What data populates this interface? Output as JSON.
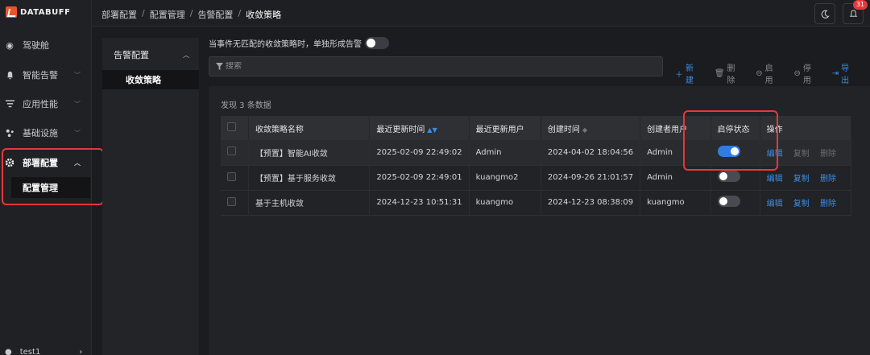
{
  "app": {
    "logo_text": "DATABUFF"
  },
  "nav": {
    "items": [
      {
        "label": "驾驶舱",
        "icon": "cockpit-icon"
      },
      {
        "label": "智能告警",
        "icon": "bell-icon"
      },
      {
        "label": "应用性能",
        "icon": "apm-icon"
      },
      {
        "label": "基础设施",
        "icon": "infrastructure-icon"
      },
      {
        "label": "部署配置",
        "icon": "gear-icon"
      }
    ],
    "sub_item": "配置管理",
    "user": "test1"
  },
  "topbar": {
    "breadcrumb": [
      "部署配置",
      "配置管理",
      "告警配置",
      "收敛策略"
    ],
    "notification_count": "31"
  },
  "submenu": {
    "group": "告警配置",
    "item": "收敛策略"
  },
  "main": {
    "toggle_label": "当事件无匹配的收敛策略时，单独形成告警",
    "search_placeholder": "搜索",
    "actions": {
      "new": "新建",
      "delete": "删除",
      "enable": "启用",
      "disable": "停用",
      "export": "导出"
    },
    "found_text": "发现 3 条数据",
    "columns": [
      "收敛策略名称",
      "最近更新时间",
      "最近更新用户",
      "创建时间",
      "创建者用户",
      "启停状态",
      "操作"
    ],
    "rows": [
      {
        "name": "【预置】智能AI收敛",
        "updated": "2025-02-09 22:49:02",
        "updated_by": "Admin",
        "created": "2024-04-02 18:04:56",
        "creator": "Admin",
        "enabled": true,
        "ops": [
          "编辑",
          "复制",
          "删除"
        ]
      },
      {
        "name": "【预置】基于服务收敛",
        "updated": "2025-02-09 22:49:01",
        "updated_by": "kuangmo2",
        "created": "2024-09-26 21:01:57",
        "creator": "Admin",
        "enabled": false,
        "ops": [
          "编辑",
          "复制",
          "删除"
        ]
      },
      {
        "name": "基于主机收敛",
        "updated": "2024-12-23 10:51:31",
        "updated_by": "kuangmo",
        "created": "2024-12-23 08:38:09",
        "creator": "kuangmo",
        "enabled": false,
        "ops": [
          "编辑",
          "复制",
          "删除"
        ]
      }
    ]
  },
  "colors": {
    "accent": "#2f7de1",
    "highlight": "#e5383b",
    "brand": "#e8552a"
  }
}
